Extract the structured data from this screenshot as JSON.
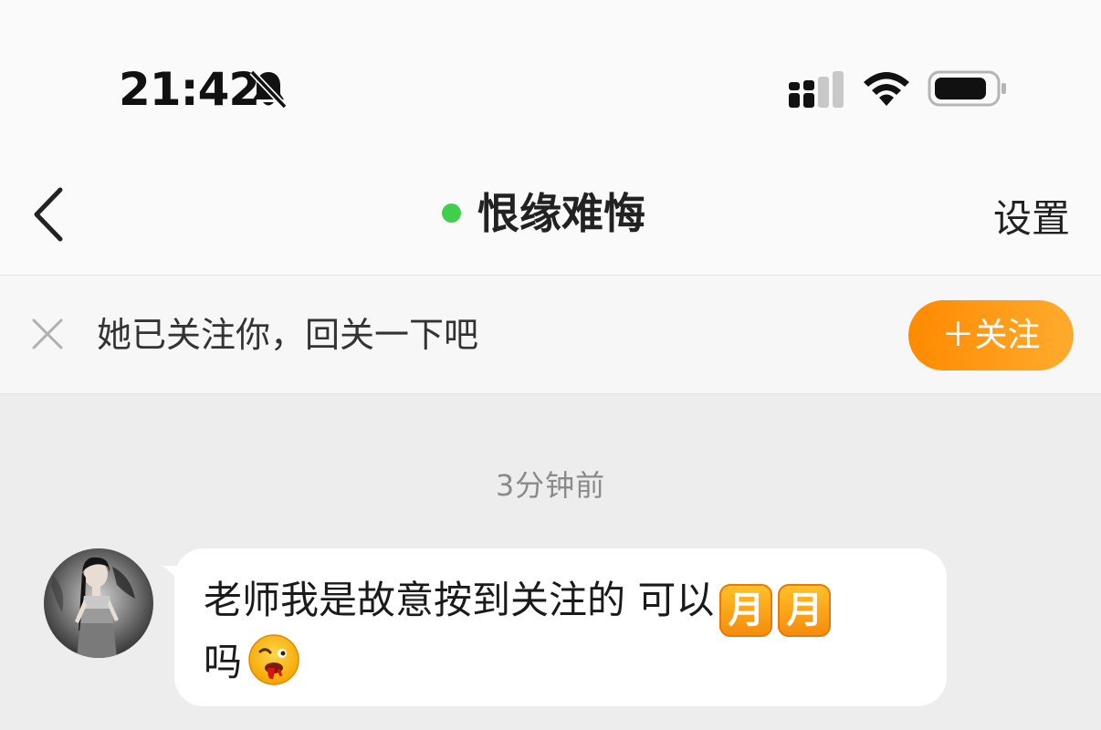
{
  "status_bar": {
    "time": "21:42",
    "bell_icon": "bell-slash-icon",
    "signal_icon": "cellular-signal-icon",
    "wifi_icon": "wifi-icon",
    "battery_icon": "battery-icon"
  },
  "nav": {
    "back_icon": "chevron-left-icon",
    "title": "恨缘难悔",
    "online_color": "#3ed04a",
    "settings_label": "设置"
  },
  "follow_banner": {
    "close_icon": "close-icon",
    "text": "她已关注你，回关一下吧",
    "button_label": "＋关注",
    "button_color": "#ff9a14"
  },
  "chat": {
    "timestamp": "3分钟前",
    "messages": [
      {
        "line1": "老师我是故意按到关注的 可以",
        "emoji1": "月",
        "emoji2": "月",
        "line2": "吗",
        "emoji3": "drooling-face-emoji"
      }
    ]
  }
}
